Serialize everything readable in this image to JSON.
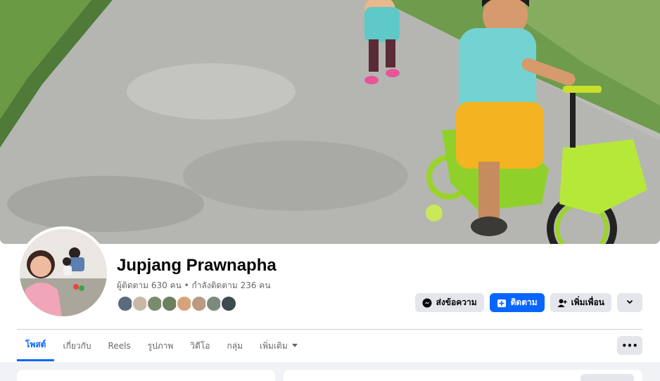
{
  "profile": {
    "name": "Jupjang Prawnapha",
    "stats": "ผู้ติดตาม 630 คน • กำลังติดตาม 236 คน",
    "friend_avatar_colors": [
      "#5b6a7d",
      "#c9b8a6",
      "#7a8c6e",
      "#6c7f5e",
      "#d8a27a",
      "#b89b80",
      "#7d8a7b",
      "#3f4a4e"
    ]
  },
  "actions": {
    "message_label": "ส่งข้อความ",
    "follow_label": "ติดตาม",
    "add_friend_label": "เพิ่มเพื่อน"
  },
  "tabs": [
    {
      "label": "โพสต์",
      "active": true
    },
    {
      "label": "เกี่ยวกับ",
      "active": false
    },
    {
      "label": "Reels",
      "active": false
    },
    {
      "label": "รูปภาพ",
      "active": false
    },
    {
      "label": "วิดีโอ",
      "active": false
    },
    {
      "label": "กลุ่ม",
      "active": false
    },
    {
      "label": "เพิ่มเติม",
      "active": false
    }
  ],
  "more_options_label": "•••",
  "colors": {
    "accent": "#0866ff",
    "secondary_button": "#e4e6eb",
    "muted_text": "#65676b"
  }
}
